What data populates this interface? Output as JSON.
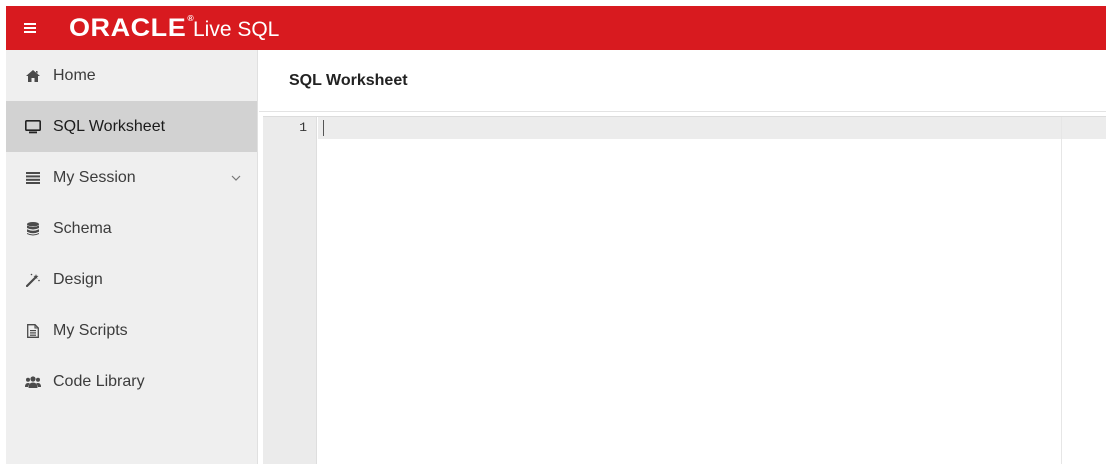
{
  "topbar": {
    "brand_logo": "ORACLE",
    "brand_tm": "®",
    "brand_product": "Live SQL",
    "bg_color": "#d81a1f"
  },
  "sidebar": {
    "items": [
      {
        "label": "Home",
        "icon": "home-icon",
        "active": false
      },
      {
        "label": "SQL Worksheet",
        "icon": "monitor-icon",
        "active": true
      },
      {
        "label": "My Session",
        "icon": "list-icon",
        "active": false,
        "expandable": true
      },
      {
        "label": "Schema",
        "icon": "database-icon",
        "active": false
      },
      {
        "label": "Design",
        "icon": "magic-wand-icon",
        "active": false
      },
      {
        "label": "My Scripts",
        "icon": "document-icon",
        "active": false
      },
      {
        "label": "Code Library",
        "icon": "users-icon",
        "active": false
      }
    ]
  },
  "main": {
    "title": "SQL Worksheet"
  },
  "editor": {
    "line_numbers": [
      "1"
    ],
    "content": ""
  }
}
